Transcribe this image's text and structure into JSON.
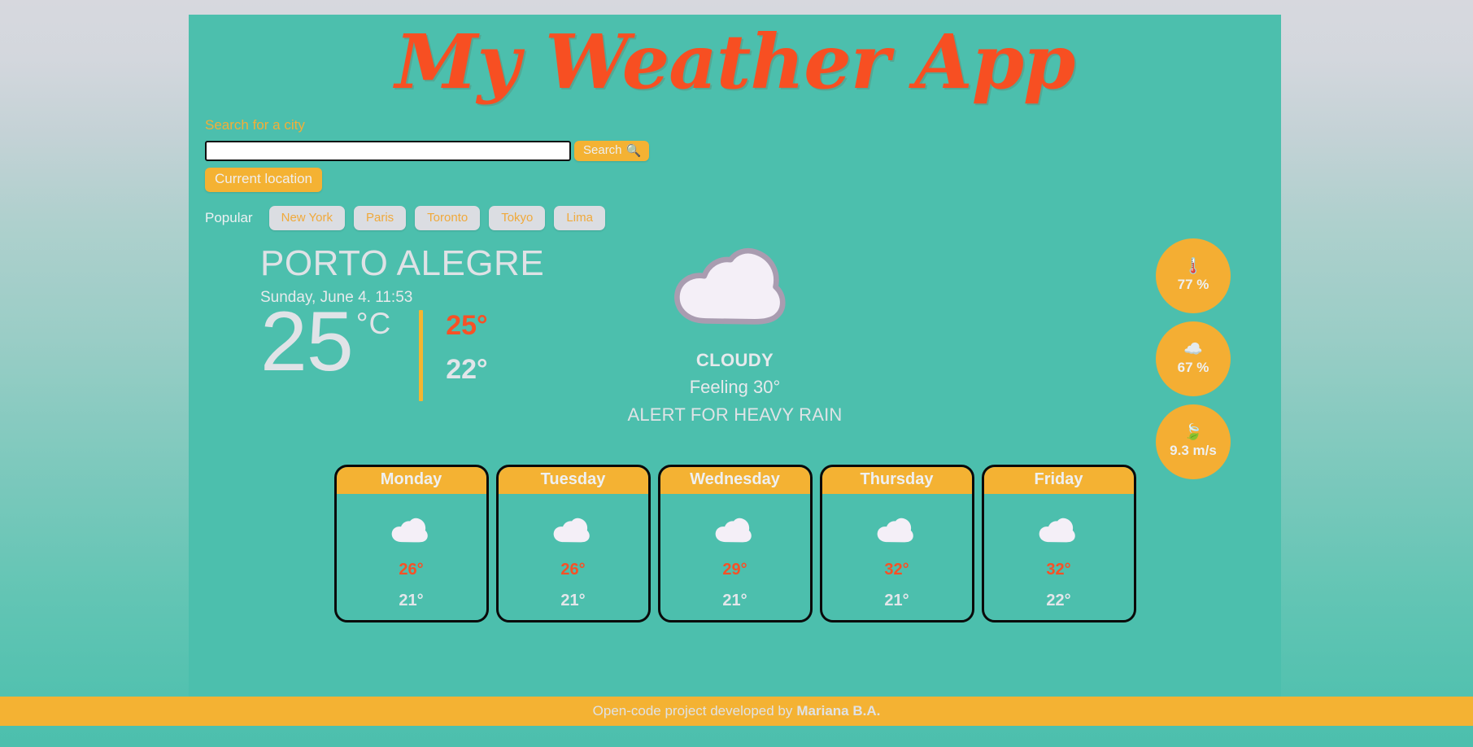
{
  "header": {
    "title": "My Weather App"
  },
  "search": {
    "label": "Search for a city",
    "value": "",
    "placeholder": "",
    "search_button_label": "Search",
    "search_icon": "magnifier-icon",
    "current_location_label": "Current location"
  },
  "popular": {
    "label": "Popular",
    "cities": [
      "New York",
      "Paris",
      "Toronto",
      "Tokyo",
      "Lima"
    ]
  },
  "current": {
    "city": "PORTO ALEGRE",
    "datetime": "Sunday, June 4. 11:53",
    "temperature": "25",
    "unit": "°C",
    "temp_max": "25°",
    "temp_min": "22°",
    "condition": "CLOUDY",
    "feels_like": "Feeling 30°",
    "alert": "ALERT FOR HEAVY RAIN",
    "condition_icon": "cloud-icon"
  },
  "stats": [
    {
      "icon": "thermometer-icon",
      "emoji": "🌡️",
      "value": "77 %"
    },
    {
      "icon": "cloud-icon",
      "emoji": "☁️",
      "value": "67 %"
    },
    {
      "icon": "wind-leaf-icon",
      "emoji": "🍃",
      "value": "9.3 m/s"
    }
  ],
  "forecast": [
    {
      "day": "Monday",
      "icon": "cloud-icon",
      "max": "26°",
      "min": "21°"
    },
    {
      "day": "Tuesday",
      "icon": "cloud-icon",
      "max": "26°",
      "min": "21°"
    },
    {
      "day": "Wednesday",
      "icon": "cloud-icon",
      "max": "29°",
      "min": "21°"
    },
    {
      "day": "Thursday",
      "icon": "cloud-icon",
      "max": "32°",
      "min": "21°"
    },
    {
      "day": "Friday",
      "icon": "cloud-icon",
      "max": "32°",
      "min": "22°"
    }
  ],
  "footer": {
    "text": "Open-code project developed by",
    "author": "Mariana B.A."
  },
  "colors": {
    "teal": "#4cbfad",
    "amber": "#f4b233",
    "orange_red": "#f74f22",
    "light_gray": "#e0e3e7",
    "chip_gray": "#dbdde2"
  }
}
